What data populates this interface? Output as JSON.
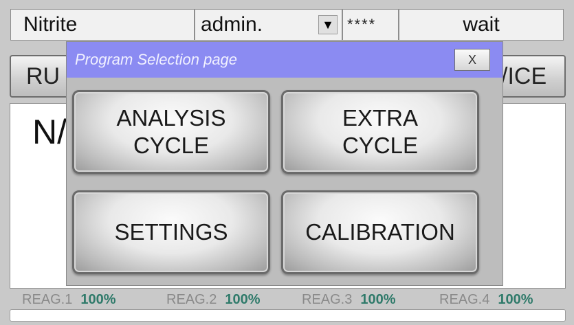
{
  "status_bar": {
    "parameter": "Nitrite",
    "user": "admin.",
    "password_mask": "****",
    "status": "wait"
  },
  "nav": {
    "left_partial": "RU",
    "right_partial": "/ICE"
  },
  "main": {
    "partial_value": "N/"
  },
  "popup": {
    "title": "Program Selection page",
    "close_label": "X",
    "buttons": {
      "analysis": "ANALYSIS\nCYCLE",
      "extra": "EXTRA\nCYCLE",
      "settings": "SETTINGS",
      "calibration": "CALIBRATION"
    }
  },
  "reagents": [
    {
      "label": "REAG.1",
      "value": "100%"
    },
    {
      "label": "REAG.2",
      "value": "100%"
    },
    {
      "label": "REAG.3",
      "value": "100%"
    },
    {
      "label": "REAG.4",
      "value": "100%"
    }
  ]
}
